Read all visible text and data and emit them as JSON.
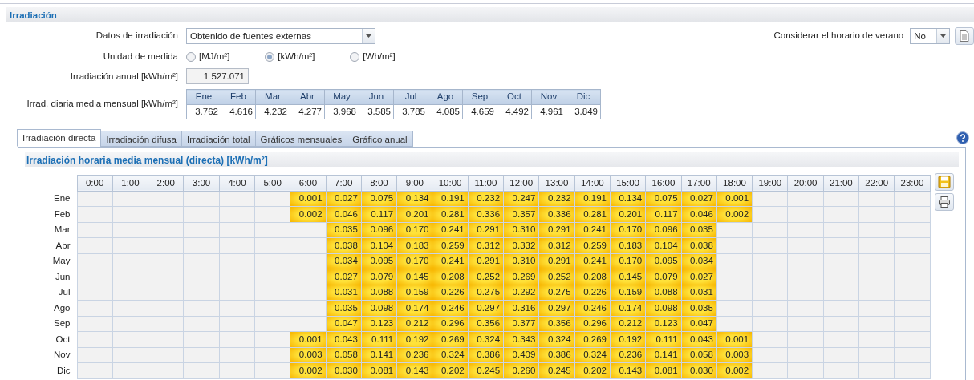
{
  "section_title": "Irradiación",
  "irradiation_data": {
    "label": "Datos de irradiación",
    "value": "Obtenido de fuentes externas"
  },
  "daylight_saving": {
    "label": "Considerar el horario de verano",
    "value": "No"
  },
  "unit": {
    "label": "Unidad de medida",
    "options": [
      {
        "label": "[MJ/m²]",
        "selected": false
      },
      {
        "label": "[kWh/m²]",
        "selected": true
      },
      {
        "label": "[Wh/m²]",
        "selected": false
      }
    ]
  },
  "annual": {
    "label": "Irradiación anual [kWh/m²]",
    "value": "1 527.071"
  },
  "monthly": {
    "label": "Irrad. diaria media mensual [kWh/m²]",
    "months": [
      "Ene",
      "Feb",
      "Mar",
      "Abr",
      "May",
      "Jun",
      "Jul",
      "Ago",
      "Sep",
      "Oct",
      "Nov",
      "Dic"
    ],
    "values": [
      "3.762",
      "4.616",
      "4.232",
      "4.277",
      "3.968",
      "3.585",
      "3.785",
      "4.085",
      "4.659",
      "4.492",
      "4.961",
      "3.849"
    ]
  },
  "tabs": [
    {
      "label": "Irradiación directa",
      "selected": true
    },
    {
      "label": "Irradiación difusa",
      "selected": false
    },
    {
      "label": "Irradiación total",
      "selected": false
    },
    {
      "label": "Gráficos mensuales",
      "selected": false
    },
    {
      "label": "Gráfico anual",
      "selected": false
    }
  ],
  "panel_title": "Irradiación horaria media mensual (directa) [kWh/m²]",
  "hours": [
    "0:00",
    "1:00",
    "2:00",
    "3:00",
    "4:00",
    "5:00",
    "6:00",
    "7:00",
    "8:00",
    "9:00",
    "10:00",
    "11:00",
    "12:00",
    "13:00",
    "14:00",
    "15:00",
    "16:00",
    "17:00",
    "18:00",
    "19:00",
    "20:00",
    "21:00",
    "22:00",
    "23:00"
  ],
  "rows": [
    {
      "month": "Ene",
      "cells": [
        null,
        null,
        null,
        null,
        null,
        null,
        "0.001",
        "0.027",
        "0.075",
        "0.134",
        "0.191",
        "0.232",
        "0.247",
        "0.232",
        "0.191",
        "0.134",
        "0.075",
        "0.027",
        "0.001",
        null,
        null,
        null,
        null,
        null
      ]
    },
    {
      "month": "Feb",
      "cells": [
        null,
        null,
        null,
        null,
        null,
        null,
        "0.002",
        "0.046",
        "0.117",
        "0.201",
        "0.281",
        "0.336",
        "0.357",
        "0.336",
        "0.281",
        "0.201",
        "0.117",
        "0.046",
        "0.002",
        null,
        null,
        null,
        null,
        null
      ]
    },
    {
      "month": "Mar",
      "cells": [
        null,
        null,
        null,
        null,
        null,
        null,
        null,
        "0.035",
        "0.096",
        "0.170",
        "0.241",
        "0.291",
        "0.310",
        "0.291",
        "0.241",
        "0.170",
        "0.096",
        "0.035",
        null,
        null,
        null,
        null,
        null,
        null
      ]
    },
    {
      "month": "Abr",
      "cells": [
        null,
        null,
        null,
        null,
        null,
        null,
        null,
        "0.038",
        "0.104",
        "0.183",
        "0.259",
        "0.312",
        "0.332",
        "0.312",
        "0.259",
        "0.183",
        "0.104",
        "0.038",
        null,
        null,
        null,
        null,
        null,
        null
      ]
    },
    {
      "month": "May",
      "cells": [
        null,
        null,
        null,
        null,
        null,
        null,
        null,
        "0.034",
        "0.095",
        "0.170",
        "0.241",
        "0.291",
        "0.310",
        "0.291",
        "0.241",
        "0.170",
        "0.095",
        "0.034",
        null,
        null,
        null,
        null,
        null,
        null
      ]
    },
    {
      "month": "Jun",
      "cells": [
        null,
        null,
        null,
        null,
        null,
        null,
        null,
        "0.027",
        "0.079",
        "0.145",
        "0.208",
        "0.252",
        "0.269",
        "0.252",
        "0.208",
        "0.145",
        "0.079",
        "0.027",
        null,
        null,
        null,
        null,
        null,
        null
      ]
    },
    {
      "month": "Jul",
      "cells": [
        null,
        null,
        null,
        null,
        null,
        null,
        null,
        "0.031",
        "0.088",
        "0.159",
        "0.226",
        "0.275",
        "0.292",
        "0.275",
        "0.226",
        "0.159",
        "0.088",
        "0.031",
        null,
        null,
        null,
        null,
        null,
        null
      ]
    },
    {
      "month": "Ago",
      "cells": [
        null,
        null,
        null,
        null,
        null,
        null,
        null,
        "0.035",
        "0.098",
        "0.174",
        "0.246",
        "0.297",
        "0.316",
        "0.297",
        "0.246",
        "0.174",
        "0.098",
        "0.035",
        null,
        null,
        null,
        null,
        null,
        null
      ]
    },
    {
      "month": "Sep",
      "cells": [
        null,
        null,
        null,
        null,
        null,
        null,
        null,
        "0.047",
        "0.123",
        "0.212",
        "0.296",
        "0.356",
        "0.377",
        "0.356",
        "0.296",
        "0.212",
        "0.123",
        "0.047",
        null,
        null,
        null,
        null,
        null,
        null
      ]
    },
    {
      "month": "Oct",
      "cells": [
        null,
        null,
        null,
        null,
        null,
        null,
        "0.001",
        "0.043",
        "0.111",
        "0.192",
        "0.269",
        "0.324",
        "0.343",
        "0.324",
        "0.269",
        "0.192",
        "0.111",
        "0.043",
        "0.001",
        null,
        null,
        null,
        null,
        null
      ]
    },
    {
      "month": "Nov",
      "cells": [
        null,
        null,
        null,
        null,
        null,
        null,
        "0.003",
        "0.058",
        "0.141",
        "0.236",
        "0.324",
        "0.386",
        "0.409",
        "0.386",
        "0.324",
        "0.236",
        "0.141",
        "0.058",
        "0.003",
        null,
        null,
        null,
        null,
        null
      ]
    },
    {
      "month": "Dic",
      "cells": [
        null,
        null,
        null,
        null,
        null,
        null,
        "0.002",
        "0.030",
        "0.081",
        "0.143",
        "0.202",
        "0.245",
        "0.260",
        "0.245",
        "0.202",
        "0.143",
        "0.081",
        "0.030",
        "0.002",
        null,
        null,
        null,
        null,
        null
      ]
    }
  ]
}
